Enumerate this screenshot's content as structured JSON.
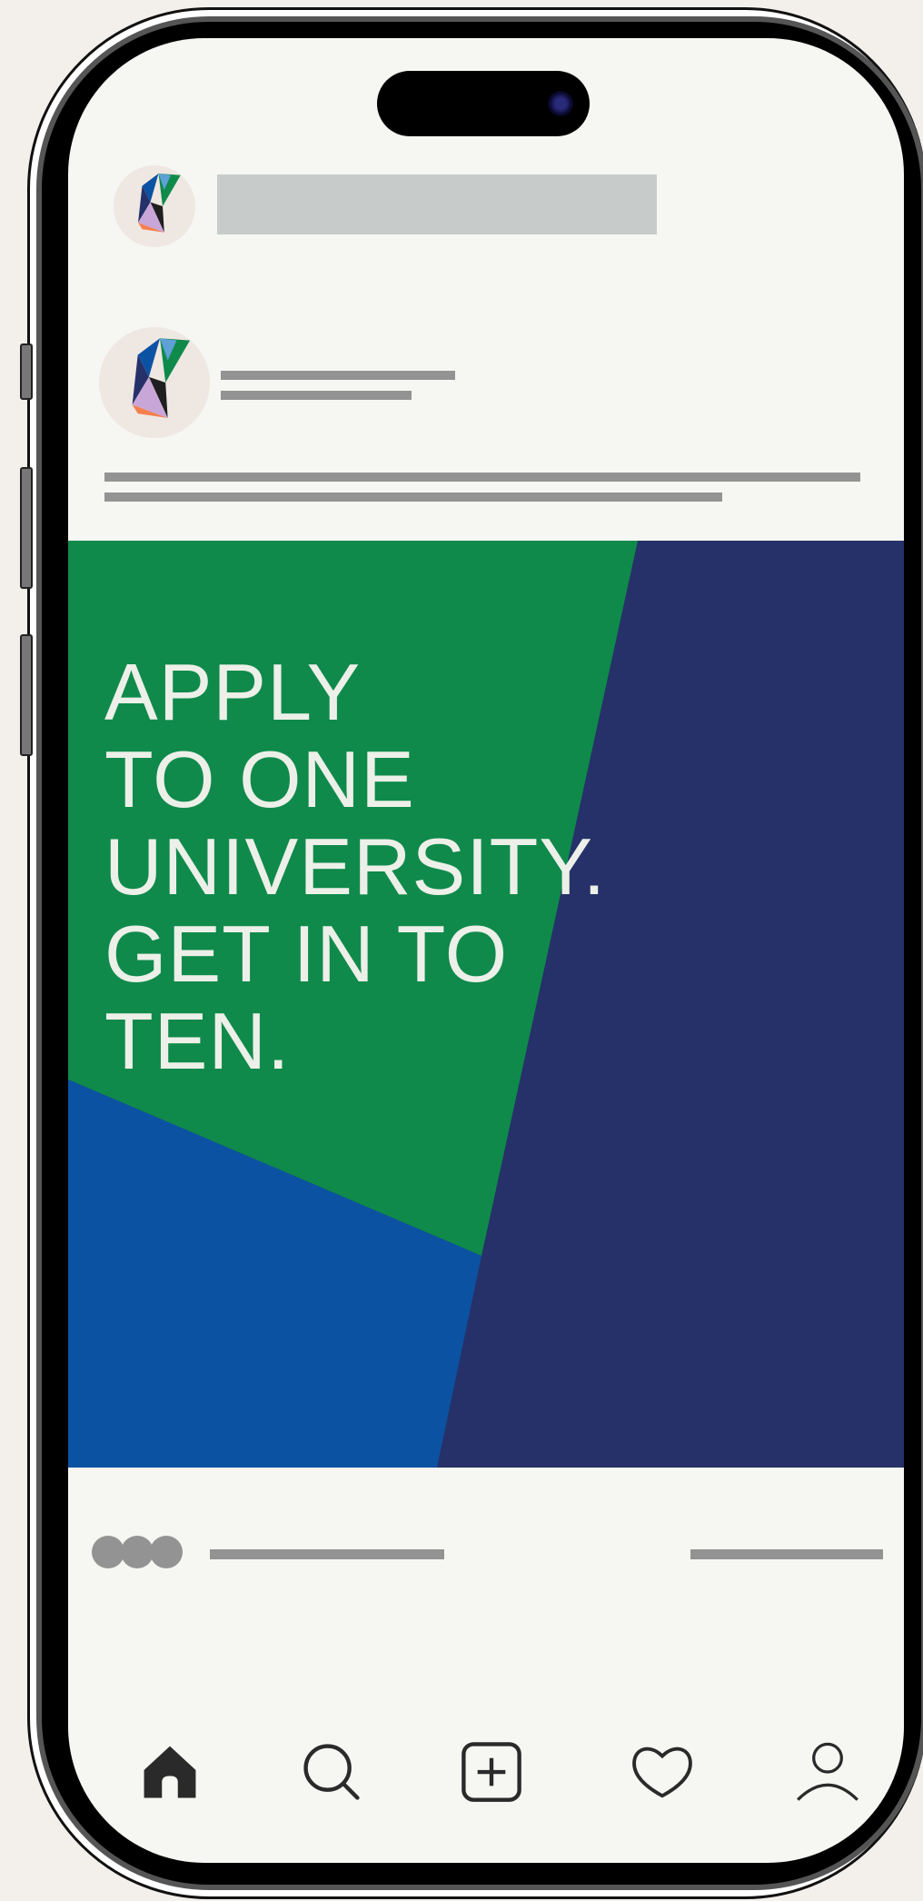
{
  "post": {
    "headline": "APPLY\nTO ONE\nUNIVERSITY.\nGET IN TO\nTEN."
  },
  "colors": {
    "background": "#f6f6f2",
    "green": "#0f8a4b",
    "navy": "#253168",
    "blue": "#0c52a3",
    "headline_text": "#ecf0e8",
    "placeholder_bar": "#939393",
    "story_bar": "#c7cccb"
  },
  "tabbar": {
    "items": [
      {
        "icon": "home-icon",
        "active": true
      },
      {
        "icon": "search-icon",
        "active": false
      },
      {
        "icon": "add-post-icon",
        "active": false
      },
      {
        "icon": "heart-icon",
        "active": false
      },
      {
        "icon": "profile-icon",
        "active": false
      }
    ]
  }
}
